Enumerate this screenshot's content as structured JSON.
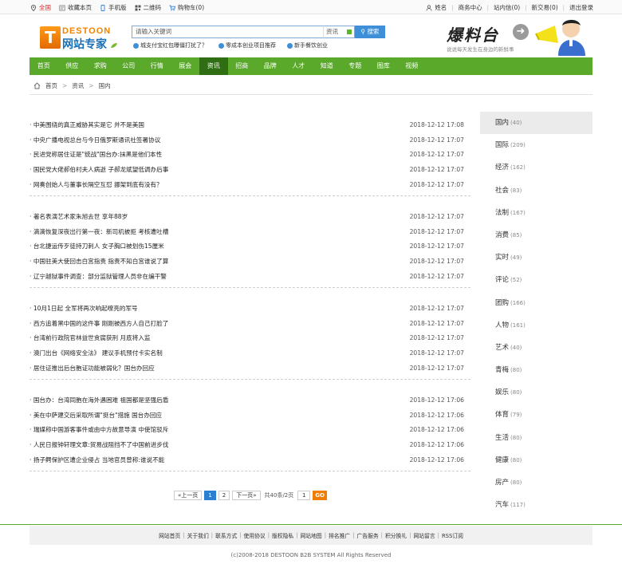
{
  "topbar": {
    "location": "全国",
    "fav": "收藏本页",
    "mobile": "手机版",
    "qrcode": "二维码",
    "cart": "购物车(0)",
    "user": "姓名",
    "biz": "商务中心",
    "inbox": "站内信(0)",
    "deal": "新交易(0)",
    "logout": "退出登录"
  },
  "logo": {
    "en": "DESTOON",
    "cn": "网站专家",
    "icon_letter": "T"
  },
  "search": {
    "placeholder": "请输入关键词",
    "scope": "资讯",
    "button": "搜索",
    "hot": [
      "城支付宝红包曝僵打扰了？",
      "零成本创业项目推荐",
      "新手餐饮创业"
    ]
  },
  "promo": {
    "title": "爆料台",
    "subtitle": "说说每天发生在身边的新鲜事"
  },
  "nav": [
    "首页",
    "供应",
    "求购",
    "公司",
    "行情",
    "展会",
    "资讯",
    "招商",
    "品牌",
    "人才",
    "知道",
    "专题",
    "图库",
    "视频"
  ],
  "nav_active": "资讯",
  "breadcrumb": {
    "home": "首页",
    "level1": "资讯",
    "level2": "国内",
    "sep": ">"
  },
  "groups": [
    [
      {
        "title": "· 中美围绕的真正威胁其实是它 并不是美国",
        "date": "2018-12-12 17:08"
      },
      {
        "title": "· 中央广播电视总台与今日俄罗斯通讯社签署协议",
        "date": "2018-12-12 17:07"
      },
      {
        "title": "· 民进党称居住证是\"统战\"国台办:抹黑是他们本性",
        "date": "2018-12-12 17:07"
      },
      {
        "title": "· 国民党大佬郝伯村夫人病逝 子郝龙斌望低调办后事",
        "date": "2018-12-12 17:07"
      },
      {
        "title": "· 网奏创始人与董事长隔空互怼 挪架到底有没有？",
        "date": "2018-12-12 17:07"
      }
    ],
    [
      {
        "title": "· 著名表演艺术家朱旭去世 享年88岁",
        "date": "2018-12-12 17:07"
      },
      {
        "title": "· 滴滴恢复深夜出行第一夜：新司机被拒 考核遭吐槽",
        "date": "2018-12-12 17:07"
      },
      {
        "title": "· 台北捷运传歹徒持刀刺人 女子胸口被划伤15厘米",
        "date": "2018-12-12 17:07"
      },
      {
        "title": "· 中国驻美大使回击白宫指责 指责不知白宫谁说了算",
        "date": "2018-12-12 17:07"
      },
      {
        "title": "· 辽宁越狱事件调查：部分监狱管理人员非在编干警",
        "date": "2018-12-12 17:07"
      }
    ],
    [
      {
        "title": "· 10月1日起 全军将再次响起嘹亮的军号",
        "date": "2018-12-12 17:07"
      },
      {
        "title": "· 西方追着黑中国的这件事 刚刚被西方人自己打脸了",
        "date": "2018-12-12 17:07"
      },
      {
        "title": "· 台湾前行政院官林益世贪腐获刑 月底将入监",
        "date": "2018-12-12 17:07"
      },
      {
        "title": "· 澳门出台《网络安全法》 建议手机预付卡实名制",
        "date": "2018-12-12 17:07"
      },
      {
        "title": "· 居住证推出后台胞证功能被弱化？国台办回应",
        "date": "2018-12-12 17:07"
      }
    ],
    [
      {
        "title": "· 国台办：台湾同胞在海外遇困难 祖国都是坚强后盾",
        "date": "2018-12-12 17:06"
      },
      {
        "title": "· 美在中萨建交后采取所谓\"挺台\"措施 国台办回应",
        "date": "2018-12-12 17:06"
      },
      {
        "title": "· 瑞媒称中国游客事件或由中方故意导演 中使馆驳斥",
        "date": "2018-12-12 17:06"
      },
      {
        "title": "· 人民日报钟轩理文章:贸易战阻挡不了中国前进步伐",
        "date": "2018-12-12 17:06"
      },
      {
        "title": "· 扬子鳄保护区遭企业侵占 当地官员曾称:谁说不能",
        "date": "2018-12-12 17:06"
      }
    ]
  ],
  "pager": {
    "prev": "«上一页",
    "pages": [
      "1",
      "2"
    ],
    "next": "下一页»",
    "info": "共40条/2页",
    "input": "1",
    "go": "GO"
  },
  "sidebar": [
    {
      "name": "国内",
      "count": "(40)"
    },
    {
      "name": "国际",
      "count": "(209)"
    },
    {
      "name": "经济",
      "count": "(162)"
    },
    {
      "name": "社会",
      "count": "(83)"
    },
    {
      "name": "法制",
      "count": "(167)"
    },
    {
      "name": "消费",
      "count": "(85)"
    },
    {
      "name": "实时",
      "count": "(49)"
    },
    {
      "name": "评论",
      "count": "(52)"
    },
    {
      "name": "团购",
      "count": "(166)"
    },
    {
      "name": "人物",
      "count": "(161)"
    },
    {
      "name": "艺术",
      "count": "(40)"
    },
    {
      "name": "青梅",
      "count": "(80)"
    },
    {
      "name": "娱乐",
      "count": "(80)"
    },
    {
      "name": "体育",
      "count": "(79)"
    },
    {
      "name": "生活",
      "count": "(80)"
    },
    {
      "name": "健康",
      "count": "(80)"
    },
    {
      "name": "房产",
      "count": "(80)"
    },
    {
      "name": "汽车",
      "count": "(117)"
    }
  ],
  "footer": {
    "links": [
      "网站首页",
      "关于我们",
      "联系方式",
      "使用协议",
      "版权隐私",
      "网站地图",
      "排名推广",
      "广告服务",
      "积分换礼",
      "网站留言",
      "RSS订阅"
    ],
    "copyright": "(c)2008-2018 DESTOON B2B SYSTEM All Rights Reserved"
  },
  "colors": {
    "nav": "#5aa92b",
    "nav_active": "#2f6e12",
    "accent_blue": "#2b7fd3",
    "go_orange": "#f07d00"
  }
}
